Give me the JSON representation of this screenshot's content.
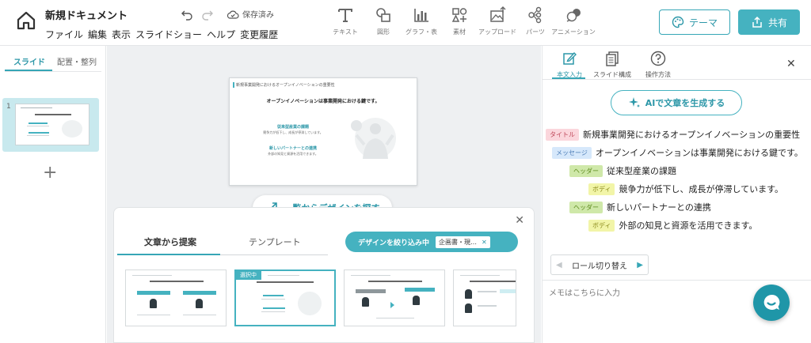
{
  "header": {
    "doc_title": "新規ドキュメント",
    "menus": [
      "ファイル",
      "編集",
      "表示",
      "スライドショー",
      "ヘルプ",
      "変更履歴"
    ],
    "save_status": "保存済み",
    "tools": [
      {
        "label": "テキスト",
        "icon": "text-icon"
      },
      {
        "label": "図形",
        "icon": "shape-icon"
      },
      {
        "label": "グラフ・表",
        "icon": "chart-icon"
      },
      {
        "label": "素材",
        "icon": "material-icon"
      },
      {
        "label": "アップロード",
        "icon": "upload-icon"
      },
      {
        "label": "パーツ",
        "icon": "parts-icon"
      },
      {
        "label": "アニメーション",
        "icon": "animation-icon"
      }
    ],
    "theme_label": "テーマ",
    "share_label": "共有",
    "accent": "#45b2c0"
  },
  "left_panel": {
    "tabs": [
      "スライド",
      "配置・整列"
    ],
    "slide_number": "1"
  },
  "slide": {
    "title": "新規事業開発におけるオープンイノベーションの重要性",
    "message": "オープンイノベーションは事業開発における鍵です。",
    "points": [
      {
        "header": "従来型産業の課題",
        "body": "競争力が低下し、成長が停滞しています。"
      },
      {
        "header": "新しいパートナーとの連携",
        "body": "外部の知見と資源を活用できます。"
      }
    ]
  },
  "canvas": {
    "find_design_label": "一覧からデザインを探す"
  },
  "design_panel": {
    "tabs": [
      "文章から提案",
      "テンプレート"
    ],
    "filter_label": "デザインを絞り込み中",
    "filter_chip": "企画書・現…",
    "selected_badge": "選択中"
  },
  "right_panel": {
    "tabs": [
      "本文入力",
      "スライド構成",
      "操作方法"
    ],
    "ai_button": "AIで文章を生成する",
    "roles": {
      "title": "タイトル",
      "message": "メッセージ",
      "header": "ヘッダー",
      "body": "ボディ"
    },
    "role_switch_label": "ロール切り替え",
    "memo_placeholder": "メモはこちらに入力"
  }
}
